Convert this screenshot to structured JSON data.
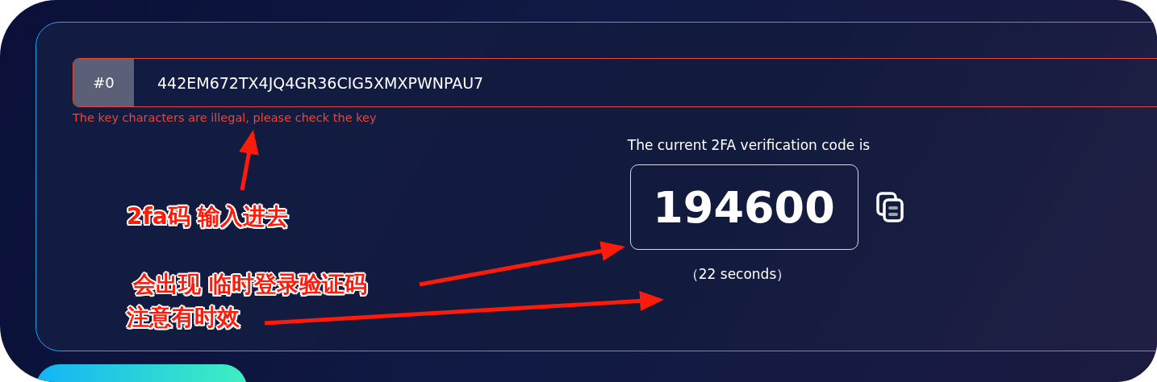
{
  "key_field": {
    "index_label": "#0",
    "value": "442EM672TX4JQ4GR36CIG5XMXPWNPAU7",
    "invalid": true,
    "error": "The key characters are illegal, please check the key"
  },
  "code_panel": {
    "caption": "The current 2FA verification code is",
    "code": "194600",
    "countdown": "（22 seconds）"
  },
  "annotations": [
    {
      "text": "2fa码 输入进去"
    },
    {
      "text": "会出现 临时登录验证码"
    },
    {
      "text": "注意有时效"
    }
  ]
}
